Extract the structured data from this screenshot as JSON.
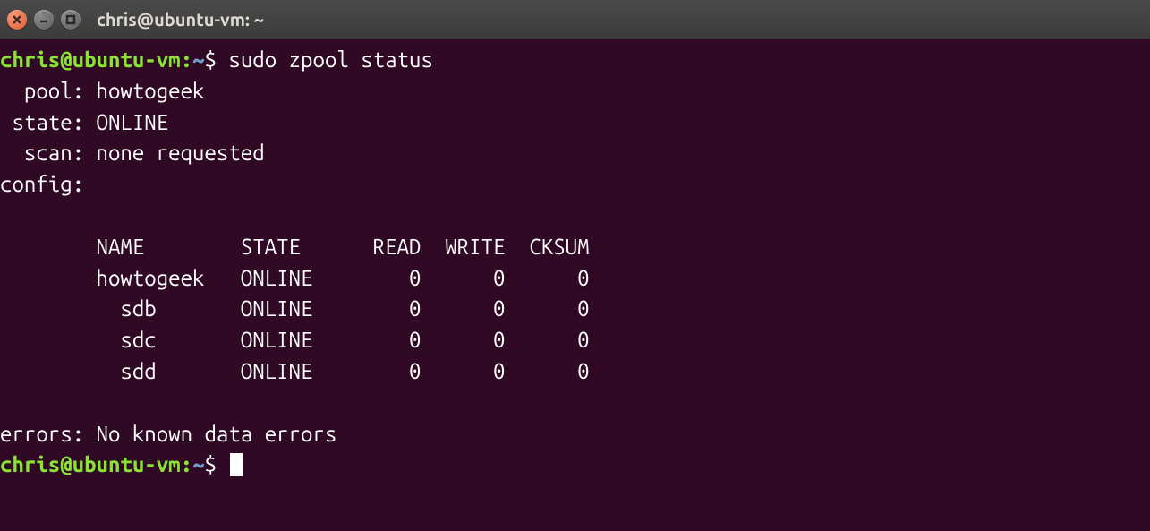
{
  "window": {
    "title": "chris@ubuntu-vm: ~"
  },
  "prompt": {
    "user_host": "chris@ubuntu-vm",
    "sep": ":",
    "path": "~",
    "sigil": "$"
  },
  "command": "sudo zpool status",
  "status": {
    "pool_label": "  pool: ",
    "pool_value": "howtogeek",
    "state_label": " state: ",
    "state_value": "ONLINE",
    "scan_label": "  scan: ",
    "scan_value": "none requested",
    "config_label": "config:"
  },
  "table": {
    "headers": {
      "name": "NAME",
      "state": "STATE",
      "read": "READ",
      "write": "WRITE",
      "cksum": "CKSUM"
    },
    "rows": [
      {
        "indent": "        ",
        "name": "howtogeek",
        "state": "ONLINE",
        "read": "0",
        "write": "0",
        "cksum": "0"
      },
      {
        "indent": "          ",
        "name": "sdb",
        "state": "ONLINE",
        "read": "0",
        "write": "0",
        "cksum": "0"
      },
      {
        "indent": "          ",
        "name": "sdc",
        "state": "ONLINE",
        "read": "0",
        "write": "0",
        "cksum": "0"
      },
      {
        "indent": "          ",
        "name": "sdd",
        "state": "ONLINE",
        "read": "0",
        "write": "0",
        "cksum": "0"
      }
    ]
  },
  "errors": {
    "label": "errors: ",
    "value": "No known data errors"
  }
}
